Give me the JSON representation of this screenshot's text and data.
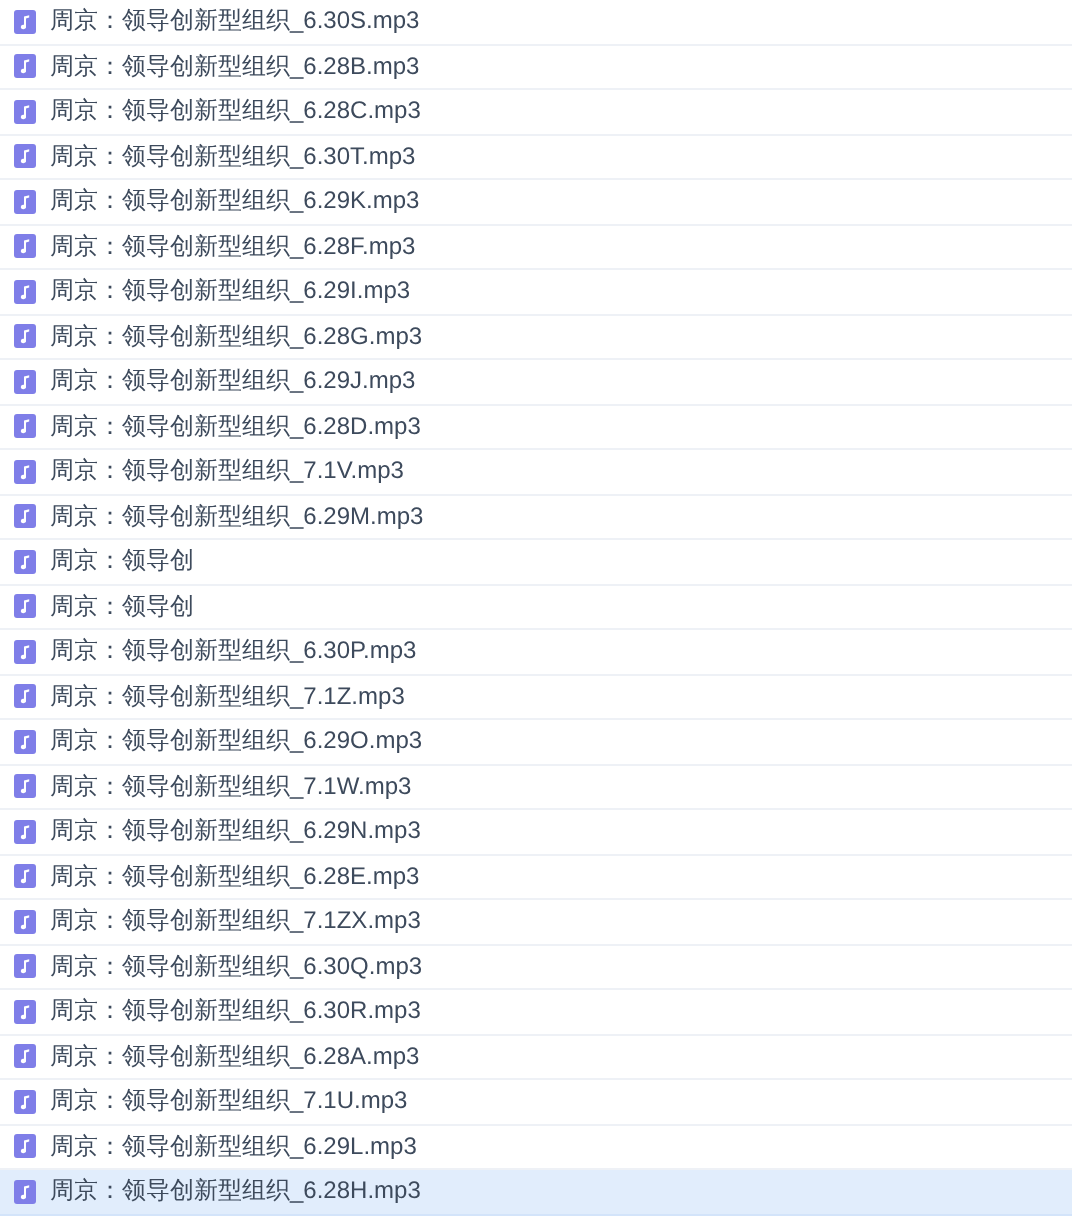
{
  "files": [
    {
      "name": "周京：领导创新型组织_6.30S.mp3",
      "selected": false
    },
    {
      "name": "周京：领导创新型组织_6.28B.mp3",
      "selected": false
    },
    {
      "name": "周京：领导创新型组织_6.28C.mp3",
      "selected": false
    },
    {
      "name": "周京：领导创新型组织_6.30T.mp3",
      "selected": false
    },
    {
      "name": "周京：领导创新型组织_6.29K.mp3",
      "selected": false
    },
    {
      "name": "周京：领导创新型组织_6.28F.mp3",
      "selected": false
    },
    {
      "name": "周京：领导创新型组织_6.29I.mp3",
      "selected": false
    },
    {
      "name": "周京：领导创新型组织_6.28G.mp3",
      "selected": false
    },
    {
      "name": "周京：领导创新型组织_6.29J.mp3",
      "selected": false
    },
    {
      "name": "周京：领导创新型组织_6.28D.mp3",
      "selected": false
    },
    {
      "name": "周京：领导创新型组织_7.1V.mp3",
      "selected": false
    },
    {
      "name": "周京：领导创新型组织_6.29M.mp3",
      "selected": false
    },
    {
      "name": "周京：领导创",
      "selected": false
    },
    {
      "name": "周京：领导创",
      "selected": false
    },
    {
      "name": "周京：领导创新型组织_6.30P.mp3",
      "selected": false
    },
    {
      "name": "周京：领导创新型组织_7.1Z.mp3",
      "selected": false
    },
    {
      "name": "周京：领导创新型组织_6.29O.mp3",
      "selected": false
    },
    {
      "name": "周京：领导创新型组织_7.1W.mp3",
      "selected": false
    },
    {
      "name": "周京：领导创新型组织_6.29N.mp3",
      "selected": false
    },
    {
      "name": "周京：领导创新型组织_6.28E.mp3",
      "selected": false
    },
    {
      "name": "周京：领导创新型组织_7.1ZX.mp3",
      "selected": false
    },
    {
      "name": "周京：领导创新型组织_6.30Q.mp3",
      "selected": false
    },
    {
      "name": "周京：领导创新型组织_6.30R.mp3",
      "selected": false
    },
    {
      "name": "周京：领导创新型组织_6.28A.mp3",
      "selected": false
    },
    {
      "name": "周京：领导创新型组织_7.1U.mp3",
      "selected": false
    },
    {
      "name": "周京：领导创新型组织_6.29L.mp3",
      "selected": false
    },
    {
      "name": "周京：领导创新型组织_6.28H.mp3",
      "selected": true
    }
  ]
}
